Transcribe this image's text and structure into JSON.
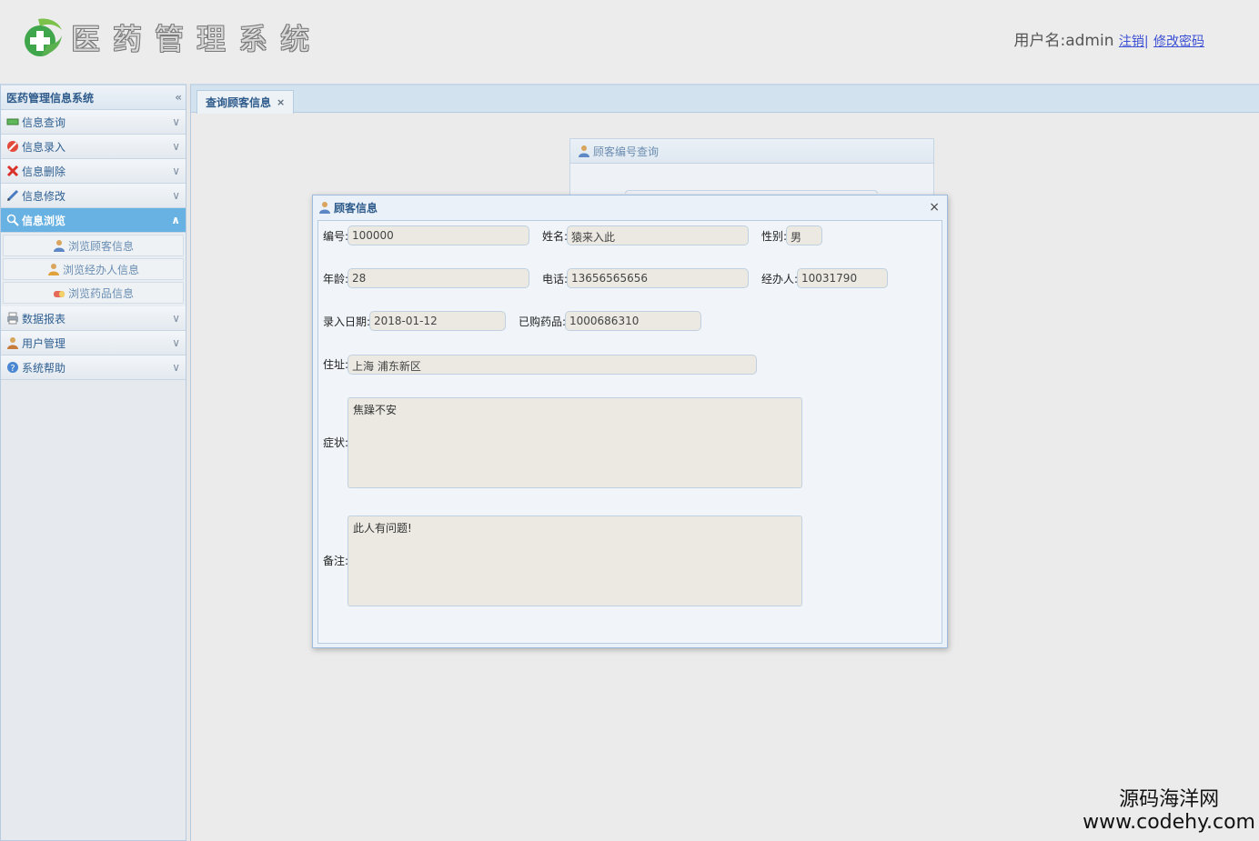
{
  "header": {
    "logo_chars": [
      "医",
      "药",
      "管",
      "理",
      "系",
      "统"
    ],
    "user_label": "用户名:admin",
    "logout_link": "注销",
    "separator": "|",
    "change_password_link": "修改密码"
  },
  "sidebar": {
    "title": "医药管理信息系统",
    "menu": [
      {
        "label": "信息查询",
        "icon": "green-bar-icon"
      },
      {
        "label": "信息录入",
        "icon": "no-entry-icon"
      },
      {
        "label": "信息删除",
        "icon": "red-x-icon"
      },
      {
        "label": "信息修改",
        "icon": "pencil-icon"
      },
      {
        "label": "信息浏览",
        "icon": "magnifier-icon"
      },
      {
        "label": "数据报表",
        "icon": "printer-icon"
      },
      {
        "label": "用户管理",
        "icon": "user-icon"
      },
      {
        "label": "系统帮助",
        "icon": "help-icon"
      }
    ],
    "submenu": [
      {
        "label": "浏览顾客信息"
      },
      {
        "label": "浏览经办人信息"
      },
      {
        "label": "浏览药品信息"
      }
    ]
  },
  "tabs": [
    {
      "label": "查询顾客信息",
      "close": "×"
    }
  ],
  "bg_panel": {
    "title": "顾客编号查询"
  },
  "dialog": {
    "title": "顾客信息",
    "close": "×",
    "fields": {
      "id_label": "编号:",
      "id_value": "100000",
      "name_label": "姓名:",
      "name_value": "猿来入此",
      "gender_label": "性别:",
      "gender_value": "男",
      "age_label": "年龄:",
      "age_value": "28",
      "phone_label": "电话:",
      "phone_value": "13656565656",
      "agent_label": "经办人:",
      "agent_value": "10031790",
      "date_label": "录入日期:",
      "date_value": "2018-01-12",
      "drug_label": "已购药品:",
      "drug_value": "1000686310",
      "address_label": "住址:",
      "address_value": "上海 浦东新区",
      "symptom_label": "症状:",
      "symptom_value": "焦躁不安",
      "remark_label": "备注:",
      "remark_value": "此人有问题!"
    }
  },
  "watermark": {
    "cn": "源码海洋网",
    "en": "www.codehy.com"
  },
  "colors": {
    "accent": "#68b1e3",
    "link": "#3b4fd3",
    "title_blue": "#2e5b8b"
  }
}
